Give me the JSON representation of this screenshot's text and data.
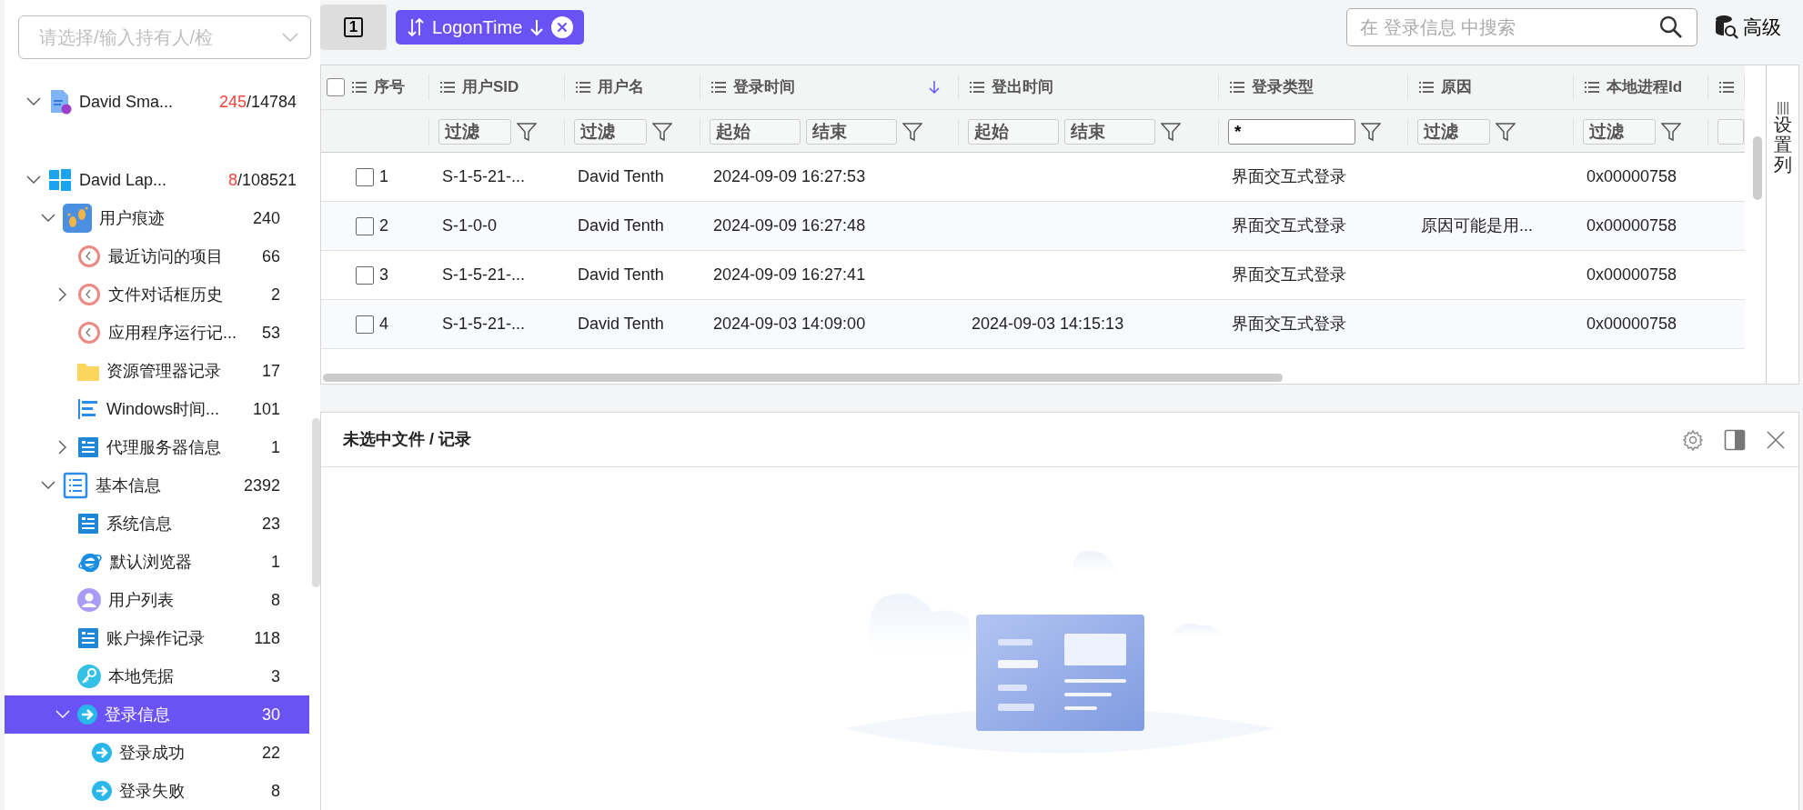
{
  "sidebar": {
    "owner_select": {
      "placeholder": "请选择/输入持有人/检"
    },
    "tree": [
      {
        "label": "David Sma...",
        "flagged": "245",
        "total": "/14784",
        "kind": "document",
        "expanded": true,
        "selected": false
      },
      {
        "label": "David Lap...",
        "flagged": "8",
        "total": "/108521",
        "kind": "windows",
        "expanded": true,
        "selected": false,
        "children": [
          {
            "label": "用户痕迹",
            "count": "240",
            "kind": "footprints",
            "expanded": true,
            "selected": false,
            "children": [
              {
                "label": "最近访问的项目",
                "count": "66",
                "kind": "clock",
                "selected": false
              },
              {
                "label": "文件对话框历史",
                "count": "2",
                "kind": "clock",
                "expanded": false,
                "selected": false
              },
              {
                "label": "应用程序运行记...",
                "count": "53",
                "kind": "clock",
                "selected": false
              },
              {
                "label": "资源管理器记录",
                "count": "17",
                "kind": "folder",
                "selected": false
              },
              {
                "label": "Windows时间...",
                "count": "101",
                "kind": "timeline",
                "selected": false
              },
              {
                "label": "代理服务器信息",
                "count": "1",
                "kind": "card",
                "expanded": false,
                "selected": false
              }
            ]
          },
          {
            "label": "基本信息",
            "count": "2392",
            "kind": "list",
            "expanded": true,
            "selected": false,
            "children": [
              {
                "label": "系统信息",
                "count": "23",
                "kind": "card",
                "selected": false
              },
              {
                "label": "默认浏览器",
                "count": "1",
                "kind": "browser",
                "selected": false
              },
              {
                "label": "用户列表",
                "count": "8",
                "kind": "user",
                "selected": false
              },
              {
                "label": "账户操作记录",
                "count": "118",
                "kind": "card",
                "selected": false
              },
              {
                "label": "本地凭据",
                "count": "3",
                "kind": "key",
                "selected": false
              },
              {
                "label": "登录信息",
                "count": "30",
                "kind": "login",
                "expanded": true,
                "selected": true,
                "children": [
                  {
                    "label": "登录成功",
                    "count": "22",
                    "kind": "login",
                    "selected": false
                  },
                  {
                    "label": "登录失败",
                    "count": "8",
                    "kind": "login",
                    "selected": false
                  }
                ]
              }
            ]
          }
        ]
      }
    ]
  },
  "toolbar": {
    "page_button": {
      "label": "1"
    },
    "sort_chip": {
      "label": "LogonTime"
    },
    "search": {
      "placeholder": "在 登录信息 中搜索"
    },
    "advanced_button": {
      "label": "高级"
    }
  },
  "table": {
    "all_checked": false,
    "columns": [
      {
        "label": "序号",
        "sorted": false
      },
      {
        "label": "用户SID",
        "sorted": false,
        "filter": {
          "kind": "text",
          "placeholder": "过滤"
        }
      },
      {
        "label": "用户名",
        "sorted": false,
        "filter": {
          "kind": "text",
          "placeholder": "过滤"
        }
      },
      {
        "label": "登录时间",
        "sorted": true,
        "filter": {
          "kind": "range",
          "fields": [
            {
              "placeholder": "起始"
            },
            {
              "placeholder": "结束"
            }
          ]
        }
      },
      {
        "label": "登出时间",
        "sorted": false,
        "filter": {
          "kind": "range",
          "fields": [
            {
              "placeholder": "起始"
            },
            {
              "placeholder": "结束"
            }
          ]
        }
      },
      {
        "label": "登录类型",
        "sorted": false,
        "filter": {
          "kind": "text",
          "value": "*"
        }
      },
      {
        "label": "原因",
        "sorted": false,
        "filter": {
          "kind": "text",
          "placeholder": "过滤"
        }
      },
      {
        "label": "本地进程Id",
        "sorted": false,
        "filter": {
          "kind": "text",
          "placeholder": "过滤"
        }
      },
      {
        "sorted": false,
        "filter": {
          "kind": "text"
        }
      }
    ],
    "rows": [
      {
        "checked": false,
        "cells": [
          "1",
          "S-1-5-21-...",
          "David Tenth",
          "2024-09-09 16:27:53",
          "",
          "界面交互式登录",
          "",
          "0x00000758"
        ]
      },
      {
        "checked": false,
        "cells": [
          "2",
          "S-1-0-0",
          "David Tenth",
          "2024-09-09 16:27:48",
          "",
          "界面交互式登录",
          "原因可能是用...",
          "0x00000758"
        ]
      },
      {
        "checked": false,
        "cells": [
          "3",
          "S-1-5-21-...",
          "David Tenth",
          "2024-09-09 16:27:41",
          "",
          "界面交互式登录",
          "",
          "0x00000758"
        ]
      },
      {
        "checked": false,
        "cells": [
          "4",
          "S-1-5-21-...",
          "David Tenth",
          "2024-09-03 14:09:00",
          "2024-09-03 14:15:13",
          "界面交互式登录",
          "",
          "0x00000758"
        ]
      }
    ],
    "column_settings": {
      "label": "设置列"
    }
  },
  "detail_panel": {
    "title": "未选中文件 / 记录"
  }
}
